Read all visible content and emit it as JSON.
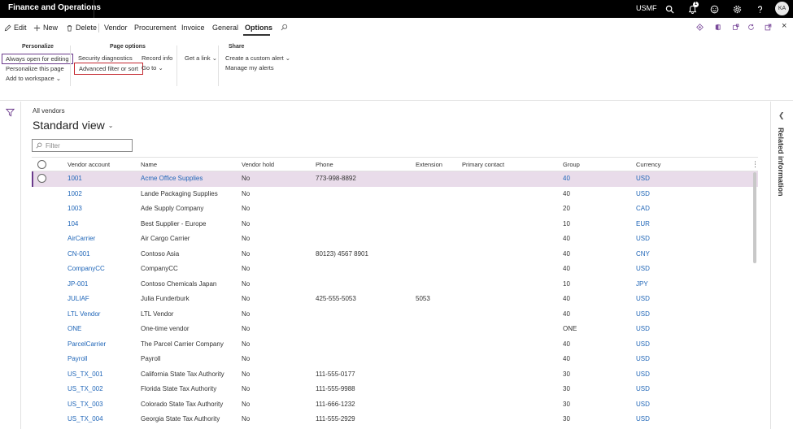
{
  "topbar": {
    "app_title": "Finance and Operations",
    "company": "USMF",
    "icons": [
      "search-icon",
      "bell-icon",
      "smiley-icon",
      "gear-icon",
      "help-icon"
    ],
    "notification_count": "1",
    "avatar": "KA",
    "close": "×"
  },
  "actionpane": {
    "edit": "Edit",
    "new": "New",
    "delete": "Delete",
    "tabs": [
      "Vendor",
      "Procurement",
      "Invoice",
      "General",
      "Options"
    ],
    "active_tab": "Options",
    "right_badge": "0"
  },
  "ribbon": {
    "personalize": {
      "title": "Personalize",
      "items": [
        "Always open for editing",
        "Personalize this page",
        "Add to workspace"
      ]
    },
    "page_options": {
      "title": "Page options",
      "items": [
        "Security diagnostics",
        "Advanced filter or sort",
        "Record info",
        "Go to"
      ]
    },
    "get_link": "Get a link",
    "share": {
      "title": "Share",
      "items": [
        "Create a custom alert",
        "Manage my alerts"
      ]
    }
  },
  "content": {
    "breadcrumb": "All vendors",
    "view_title": "Standard view",
    "filter_placeholder": "Filter"
  },
  "related_information": "Related information",
  "grid": {
    "columns": [
      "Vendor account",
      "Name",
      "Vendor hold",
      "Phone",
      "Extension",
      "Primary contact",
      "Group",
      "Currency"
    ],
    "rows": [
      {
        "account": "1001",
        "name": "Acme Office Supplies",
        "hold": "No",
        "phone": "773-998-8892",
        "ext": "",
        "contact": "",
        "group": "40",
        "currency": "USD"
      },
      {
        "account": "1002",
        "name": "Lande Packaging Supplies",
        "hold": "No",
        "phone": "",
        "ext": "",
        "contact": "",
        "group": "40",
        "currency": "USD"
      },
      {
        "account": "1003",
        "name": "Ade Supply Company",
        "hold": "No",
        "phone": "",
        "ext": "",
        "contact": "",
        "group": "20",
        "currency": "CAD"
      },
      {
        "account": "104",
        "name": "Best Supplier - Europe",
        "hold": "No",
        "phone": "",
        "ext": "",
        "contact": "",
        "group": "10",
        "currency": "EUR"
      },
      {
        "account": "AirCarrier",
        "name": "Air Cargo Carrier",
        "hold": "No",
        "phone": "",
        "ext": "",
        "contact": "",
        "group": "40",
        "currency": "USD"
      },
      {
        "account": "CN-001",
        "name": "Contoso Asia",
        "hold": "No",
        "phone": "80123) 4567 8901",
        "ext": "",
        "contact": "",
        "group": "40",
        "currency": "CNY"
      },
      {
        "account": "CompanyCC",
        "name": "CompanyCC",
        "hold": "No",
        "phone": "",
        "ext": "",
        "contact": "",
        "group": "40",
        "currency": "USD"
      },
      {
        "account": "JP-001",
        "name": "Contoso Chemicals Japan",
        "hold": "No",
        "phone": "",
        "ext": "",
        "contact": "",
        "group": "10",
        "currency": "JPY"
      },
      {
        "account": "JULIAF",
        "name": "Julia Funderburk",
        "hold": "No",
        "phone": "425-555-5053",
        "ext": "5053",
        "contact": "",
        "group": "40",
        "currency": "USD"
      },
      {
        "account": "LTL Vendor",
        "name": "LTL Vendor",
        "hold": "No",
        "phone": "",
        "ext": "",
        "contact": "",
        "group": "40",
        "currency": "USD"
      },
      {
        "account": "ONE",
        "name": "One-time vendor",
        "hold": "No",
        "phone": "",
        "ext": "",
        "contact": "",
        "group": "ONE",
        "currency": "USD"
      },
      {
        "account": "ParcelCarrier",
        "name": "The Parcel Carrier Company",
        "hold": "No",
        "phone": "",
        "ext": "",
        "contact": "",
        "group": "40",
        "currency": "USD"
      },
      {
        "account": "Payroll",
        "name": "Payroll",
        "hold": "No",
        "phone": "",
        "ext": "",
        "contact": "",
        "group": "40",
        "currency": "USD"
      },
      {
        "account": "US_TX_001",
        "name": "California State Tax Authority",
        "hold": "No",
        "phone": "111-555-0177",
        "ext": "",
        "contact": "",
        "group": "30",
        "currency": "USD"
      },
      {
        "account": "US_TX_002",
        "name": "Florida State Tax Authority",
        "hold": "No",
        "phone": "111-555-9988",
        "ext": "",
        "contact": "",
        "group": "30",
        "currency": "USD"
      },
      {
        "account": "US_TX_003",
        "name": "Colorado State Tax Authority",
        "hold": "No",
        "phone": "111-666-1232",
        "ext": "",
        "contact": "",
        "group": "30",
        "currency": "USD"
      },
      {
        "account": "US_TX_004",
        "name": "Georgia State Tax Authority",
        "hold": "No",
        "phone": "111-555-2929",
        "ext": "",
        "contact": "",
        "group": "30",
        "currency": "USD"
      }
    ]
  }
}
